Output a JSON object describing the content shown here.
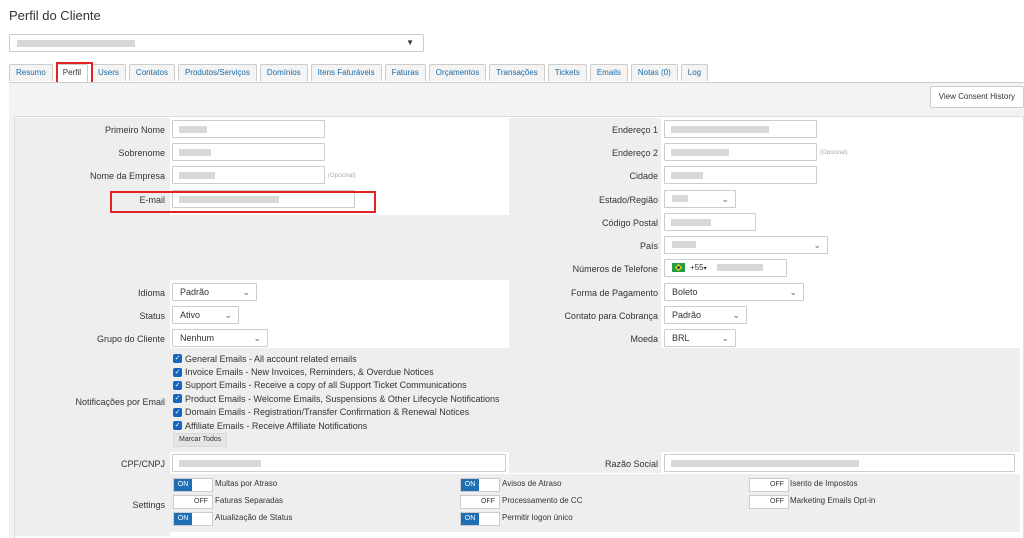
{
  "page": {
    "title": "Perfil do Cliente"
  },
  "client_select": {
    "caret": "▼"
  },
  "tabs": [
    {
      "label": "Resumo"
    },
    {
      "label": "Perfil"
    },
    {
      "label": "Users"
    },
    {
      "label": "Contatos"
    },
    {
      "label": "Produtos/Serviços"
    },
    {
      "label": "Domínios"
    },
    {
      "label": "Itens Faturáveis"
    },
    {
      "label": "Faturas"
    },
    {
      "label": "Orçamentos"
    },
    {
      "label": "Transações"
    },
    {
      "label": "Tickets"
    },
    {
      "label": "Emails"
    },
    {
      "label": "Notas (0)"
    },
    {
      "label": "Log"
    }
  ],
  "active_tab": "Perfil",
  "toolbar": {
    "consent_label": "View Consent History"
  },
  "form": {
    "first_name_label": "Primeiro Nome",
    "last_name_label": "Sobrenome",
    "company_label": "Nome da Empresa",
    "company_optional": "(Opcional)",
    "email_label": "E-mail",
    "address1_label": "Endereço 1",
    "address2_label": "Endereço 2",
    "address2_optional": "(Opcional)",
    "city_label": "Cidade",
    "state_label": "Estado/Região",
    "postcode_label": "Código Postal",
    "country_label": "País",
    "phone_label": "Números de Telefone",
    "phone_prefix": "+55",
    "language_label": "Idioma",
    "language_value": "Padrão",
    "status_label": "Status",
    "status_value": "Ativo",
    "group_label": "Grupo do Cliente",
    "group_value": "Nenhum",
    "payment_label": "Forma de Pagamento",
    "payment_value": "Boleto",
    "billing_contact_label": "Contato para Cobrança",
    "billing_contact_value": "Padrão",
    "currency_label": "Moeda",
    "currency_value": "BRL",
    "notifications_label": "Notificações por Email",
    "notifications": [
      "General Emails - All account related emails",
      "Invoice Emails - New Invoices, Reminders, & Overdue Notices",
      "Support Emails - Receive a copy of all Support Ticket Communications",
      "Product Emails - Welcome Emails, Suspensions & Other Lifecycle Notifications",
      "Domain Emails - Registration/Transfer Confirmation & Renewal Notices",
      "Affiliate Emails - Receive Affiliate Notifications"
    ],
    "mark_all_label": "Marcar Todos",
    "cpf_label": "CPF/CNPJ",
    "razao_label": "Razão Social",
    "settings_label": "Settings"
  },
  "settings": {
    "late_fees": {
      "label": "Multas por Atraso",
      "state": "ON"
    },
    "separate_invoices": {
      "label": "Faturas Separadas",
      "state": "OFF"
    },
    "status_update": {
      "label": "Atualização de Status",
      "state": "ON"
    },
    "overdue_notices": {
      "label": "Avisos de Atraso",
      "state": "ON"
    },
    "cc_processing": {
      "label": "Processamento de CC",
      "state": "OFF"
    },
    "single_sign_on": {
      "label": "Permitir logon único",
      "state": "ON"
    },
    "tax_exempt": {
      "label": "Isento de Impostos",
      "state": "OFF"
    },
    "marketing_optin": {
      "label": "Marketing Emails Opt-in",
      "state": "OFF"
    }
  },
  "colors": {
    "accent": "#1f6fb5",
    "highlight": "#e02424",
    "link": "#1a6aa5"
  },
  "icons": {
    "dropdown": "chevron-down-icon",
    "checkbox": "checkmark-icon",
    "flag": "brazil-flag-icon"
  }
}
